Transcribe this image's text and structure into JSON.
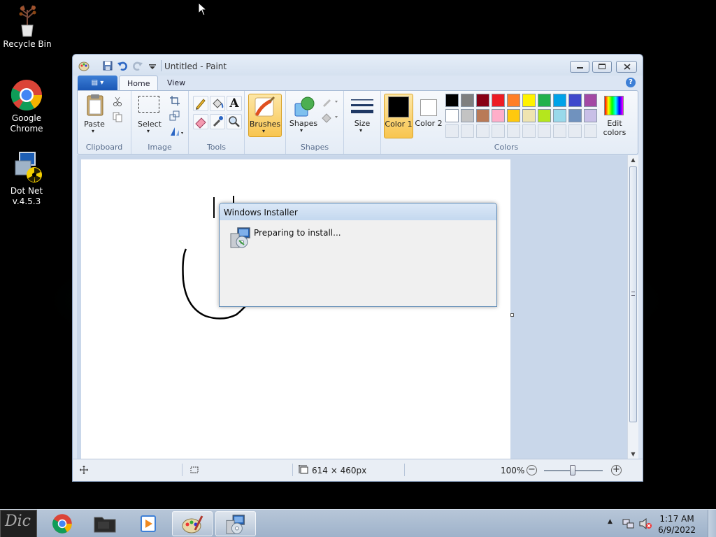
{
  "desktop": {
    "icons": [
      {
        "label": "Recycle Bin",
        "icon": "recycle-bin-icon"
      },
      {
        "label": "Google Chrome",
        "icon": "chrome-icon"
      },
      {
        "label": "Dot Net v.4.5.3",
        "icon": "installer-icon"
      }
    ]
  },
  "paint": {
    "title": "Untitled - Paint",
    "tabs": {
      "home": "Home",
      "view": "View"
    },
    "clipboard": {
      "paste": "Paste",
      "group": "Clipboard"
    },
    "image": {
      "select": "Select",
      "group": "Image"
    },
    "tools": {
      "group": "Tools"
    },
    "brushes": {
      "label": "Brushes"
    },
    "shapes": {
      "label": "Shapes",
      "group": "Shapes"
    },
    "size": {
      "label": "Size"
    },
    "colors": {
      "color1": "Color 1",
      "color2": "Color 2",
      "edit": "Edit colors",
      "group": "Colors",
      "color1_value": "#000000",
      "color2_value": "#ffffff",
      "palette_row1": [
        "#000000",
        "#7f7f7f",
        "#880015",
        "#ed1c24",
        "#ff7f27",
        "#fff200",
        "#22b14c",
        "#00a2e8",
        "#3f48cc",
        "#a349a4"
      ],
      "palette_row2": [
        "#ffffff",
        "#c3c3c3",
        "#b97a57",
        "#ffaec9",
        "#ffc90e",
        "#efe4b0",
        "#b5e61d",
        "#99d9ea",
        "#7092be",
        "#c8bfe7"
      ]
    },
    "status": {
      "dimensions": "614 × 460px",
      "zoom": "100%"
    }
  },
  "installer": {
    "title": "Windows Installer",
    "message": "Preparing to install..."
  },
  "taskbar": {
    "time": "1:17 AM",
    "date": "6/9/2022"
  }
}
